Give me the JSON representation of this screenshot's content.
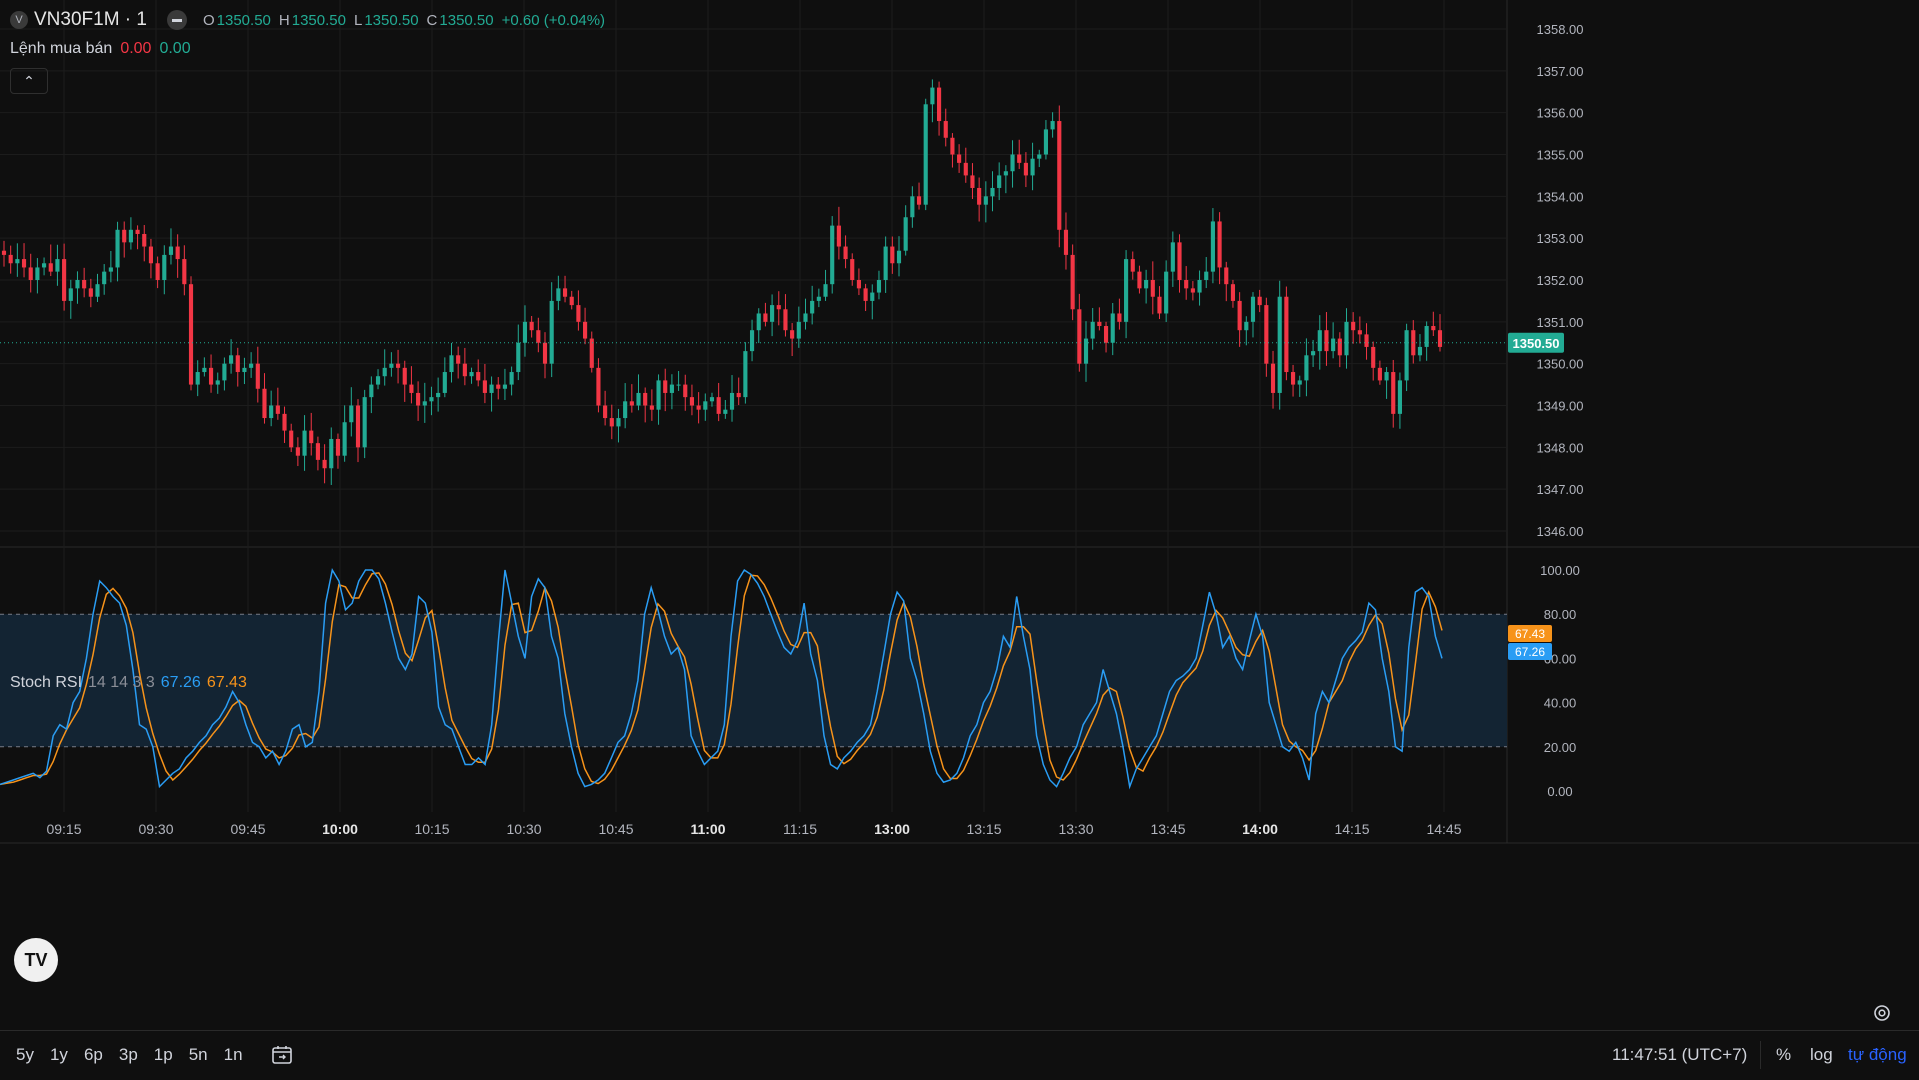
{
  "header": {
    "symbol": "VN30F1M · 1",
    "ohlc": {
      "o": "1350.50",
      "h": "1350.50",
      "l": "1350.50",
      "c": "1350.50",
      "change": "+0.60 (+0.04%)"
    }
  },
  "orders": {
    "label": "Lệnh mua bán",
    "sell": "0.00",
    "buy": "0.00"
  },
  "indicator": {
    "name": "Stoch RSI",
    "params": "14 14 3 3",
    "k_value": "67.26",
    "d_value": "67.43"
  },
  "colors": {
    "up": "#22ab94",
    "down": "#f23645",
    "k_line": "#2a9df4",
    "d_line": "#f7931a",
    "band_fill": "#132433"
  },
  "price_axis": {
    "ticks": [
      "1358.00",
      "1357.00",
      "1356.00",
      "1355.00",
      "1354.00",
      "1353.00",
      "1352.00",
      "1351.00",
      "1350.00",
      "1349.00",
      "1348.00",
      "1347.00",
      "1346.00"
    ],
    "last_price": "1350.50"
  },
  "rsi_axis": {
    "ticks": [
      "100.00",
      "80.00",
      "60.00",
      "40.00",
      "20.00",
      "0.00"
    ],
    "k_label": "67.26",
    "d_label": "67.43"
  },
  "time_axis": {
    "labels": [
      "09:15",
      "09:30",
      "09:45",
      "10:00",
      "10:15",
      "10:30",
      "10:45",
      "11:00",
      "11:15",
      "13:00",
      "13:15",
      "13:30",
      "13:45",
      "14:00",
      "14:15",
      "14:45"
    ],
    "bold": [
      "10:00",
      "11:00",
      "13:00",
      "14:00"
    ]
  },
  "bottom_bar": {
    "ranges": [
      "5y",
      "1y",
      "6p",
      "3p",
      "1p",
      "5n",
      "1n"
    ],
    "clock": "11:47:51 (UTC+7)",
    "percent": "%",
    "log": "log",
    "auto": "tự động"
  },
  "logo_text": "TV",
  "chart_data": [
    {
      "type": "candlestick",
      "ylim": [
        1345.6,
        1358.2
      ],
      "last_price": 1350.5,
      "close": [
        1352.6,
        1352.4,
        1352.5,
        1352.3,
        1352.0,
        1352.3,
        1352.4,
        1352.2,
        1352.5,
        1351.5,
        1351.8,
        1352.0,
        1351.8,
        1351.6,
        1351.9,
        1352.2,
        1352.3,
        1353.2,
        1352.9,
        1353.2,
        1353.1,
        1352.8,
        1352.4,
        1352.0,
        1352.6,
        1352.8,
        1352.5,
        1351.9,
        1349.5,
        1349.8,
        1349.9,
        1349.5,
        1349.6,
        1350.0,
        1350.2,
        1349.8,
        1349.9,
        1350.0,
        1349.4,
        1348.7,
        1349.0,
        1348.8,
        1348.4,
        1348.0,
        1347.8,
        1348.4,
        1348.1,
        1347.7,
        1347.5,
        1348.2,
        1347.8,
        1348.6,
        1349.0,
        1348.0,
        1349.2,
        1349.5,
        1349.7,
        1349.9,
        1350.0,
        1349.9,
        1349.5,
        1349.3,
        1349.0,
        1349.1,
        1349.2,
        1349.3,
        1349.8,
        1350.2,
        1350.0,
        1349.7,
        1349.8,
        1349.6,
        1349.3,
        1349.5,
        1349.4,
        1349.5,
        1349.8,
        1350.5,
        1351.0,
        1350.8,
        1350.5,
        1350.0,
        1351.5,
        1351.8,
        1351.6,
        1351.4,
        1351.0,
        1350.6,
        1349.9,
        1349.0,
        1348.7,
        1348.5,
        1348.7,
        1349.1,
        1349.0,
        1349.3,
        1349.0,
        1348.9,
        1349.6,
        1349.3,
        1349.5,
        1349.5,
        1349.2,
        1349.0,
        1348.9,
        1349.1,
        1349.2,
        1348.8,
        1348.9,
        1349.3,
        1349.2,
        1350.3,
        1350.8,
        1351.2,
        1351.0,
        1351.4,
        1351.3,
        1350.8,
        1350.6,
        1351.0,
        1351.2,
        1351.5,
        1351.6,
        1351.9,
        1353.3,
        1352.8,
        1352.5,
        1352.0,
        1351.8,
        1351.5,
        1351.7,
        1352.0,
        1352.8,
        1352.4,
        1352.7,
        1353.5,
        1354.0,
        1353.8,
        1356.2,
        1356.6,
        1355.8,
        1355.4,
        1355.0,
        1354.8,
        1354.5,
        1354.2,
        1353.8,
        1354.0,
        1354.2,
        1354.5,
        1354.6,
        1355.0,
        1354.8,
        1354.5,
        1354.9,
        1355.0,
        1355.6,
        1355.8,
        1353.2,
        1352.6,
        1351.3,
        1350.0,
        1350.6,
        1351.0,
        1350.9,
        1350.5,
        1351.2,
        1351.0,
        1352.5,
        1352.2,
        1351.8,
        1352.0,
        1351.6,
        1351.2,
        1352.2,
        1352.9,
        1352.0,
        1351.8,
        1351.7,
        1352.0,
        1352.2,
        1353.4,
        1352.3,
        1351.9,
        1351.5,
        1350.8,
        1351.0,
        1351.6,
        1351.4,
        1350.0,
        1349.3,
        1351.6,
        1349.8,
        1349.5,
        1349.6,
        1350.2,
        1350.3,
        1350.8,
        1350.3,
        1350.6,
        1350.2,
        1351.0,
        1350.8,
        1350.7,
        1350.4,
        1349.9,
        1349.6,
        1349.8,
        1348.8,
        1349.6,
        1350.8,
        1350.2,
        1350.4,
        1350.9,
        1350.8,
        1350.4
      ],
      "k": [
        3,
        4,
        5,
        6,
        7,
        8,
        6,
        9,
        25,
        30,
        28,
        40,
        45,
        60,
        80,
        95,
        92,
        88,
        85,
        75,
        55,
        30,
        28,
        20,
        2,
        5,
        8,
        10,
        15,
        18,
        22,
        25,
        30,
        33,
        38,
        45,
        40,
        30,
        22,
        20,
        15,
        18,
        12,
        18,
        28,
        30,
        20,
        22,
        45,
        85,
        100,
        95,
        82,
        85,
        95,
        100,
        100,
        96,
        85,
        72,
        60,
        55,
        62,
        88,
        85,
        72,
        38,
        30,
        28,
        20,
        12,
        12,
        15,
        12,
        30,
        68,
        100,
        85,
        70,
        60,
        88,
        96,
        92,
        70,
        60,
        35,
        20,
        8,
        2,
        3,
        5,
        8,
        15,
        22,
        25,
        35,
        50,
        80,
        92,
        82,
        70,
        62,
        65,
        55,
        25,
        18,
        12,
        15,
        18,
        30,
        70,
        95,
        100,
        98,
        94,
        88,
        80,
        72,
        65,
        62,
        68,
        85,
        62,
        50,
        25,
        12,
        10,
        15,
        18,
        22,
        25,
        30,
        45,
        62,
        80,
        90,
        86,
        60,
        50,
        35,
        18,
        8,
        4,
        5,
        8,
        15,
        25,
        30,
        40,
        45,
        55,
        70,
        65,
        88,
        70,
        55,
        25,
        12,
        5,
        2,
        8,
        15,
        20,
        30,
        35,
        40,
        55,
        45,
        35,
        20,
        2,
        10,
        15,
        20,
        25,
        35,
        45,
        50,
        52,
        55,
        60,
        75,
        90,
        80,
        65,
        70,
        60,
        55,
        68,
        80,
        70,
        40,
        30,
        20,
        18,
        22,
        15,
        5,
        35,
        45,
        40,
        50,
        60,
        65,
        68,
        72,
        85,
        82,
        60,
        45,
        20,
        18,
        65,
        90,
        92,
        88,
        70,
        60
      ]
    }
  ]
}
